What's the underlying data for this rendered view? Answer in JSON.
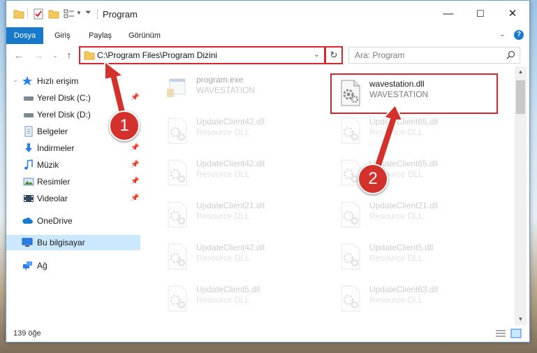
{
  "window": {
    "title": "Program",
    "controls": {
      "minimize": "—",
      "maximize": "☐",
      "close": "✕"
    }
  },
  "ribbon": {
    "tabs": [
      "Dosya",
      "Giriş",
      "Paylaş",
      "Görünüm"
    ]
  },
  "address": {
    "path": "C:\\Program Files\\Program Dizini",
    "search_placeholder": "Ara: Program"
  },
  "sidebar": {
    "quick_access": "Hızlı erişim",
    "items": [
      {
        "label": "Yerel Disk (C:)",
        "icon": "drive-icon",
        "pinned": true
      },
      {
        "label": "Yerel Disk (D:)",
        "icon": "drive-icon",
        "pinned": true
      },
      {
        "label": "Belgeler",
        "icon": "documents-icon",
        "pinned": true
      },
      {
        "label": "İndirmeler",
        "icon": "download-icon",
        "pinned": true
      },
      {
        "label": "Müzik",
        "icon": "music-icon",
        "pinned": true
      },
      {
        "label": "Resimler",
        "icon": "pictures-icon",
        "pinned": true
      },
      {
        "label": "Videolar",
        "icon": "videos-icon",
        "pinned": true
      }
    ],
    "onedrive": "OneDrive",
    "this_pc": "Bu bilgisayar",
    "network": "Ağ"
  },
  "files": [
    {
      "name": "program.exe",
      "desc": "WAVESTATION",
      "type": "exe"
    },
    {
      "name": "wavestation.dll",
      "desc": "WAVESTATION",
      "type": "dll",
      "highlighted": true
    },
    {
      "name": "UpdateClient42.dll",
      "desc": "Resource DLL",
      "type": "dll"
    },
    {
      "name": "UpdateClient65.dll",
      "desc": "Resource DLL",
      "type": "dll"
    },
    {
      "name": "UpdateClient42.dll",
      "desc": "Resource DLL",
      "type": "dll"
    },
    {
      "name": "UpdateClient65.dll",
      "desc": "Resource DLL",
      "type": "dll"
    },
    {
      "name": "UpdateClient21.dll",
      "desc": "Resource DLL",
      "type": "dll"
    },
    {
      "name": "UpdateClient21.dll",
      "desc": "Resource DLL",
      "type": "dll"
    },
    {
      "name": "UpdateClient42.dll",
      "desc": "Resource DLL",
      "type": "dll"
    },
    {
      "name": "UpdateClient5.dll",
      "desc": "Resource DLL",
      "type": "dll"
    },
    {
      "name": "UpdateClient5.dll",
      "desc": "Resource DLL",
      "type": "dll"
    },
    {
      "name": "UpdateClient63.dll",
      "desc": "Resource DLL",
      "type": "dll"
    }
  ],
  "status": {
    "count": "139 öğe"
  },
  "annotations": {
    "step1": "1",
    "step2": "2",
    "color": "#d3312b"
  }
}
